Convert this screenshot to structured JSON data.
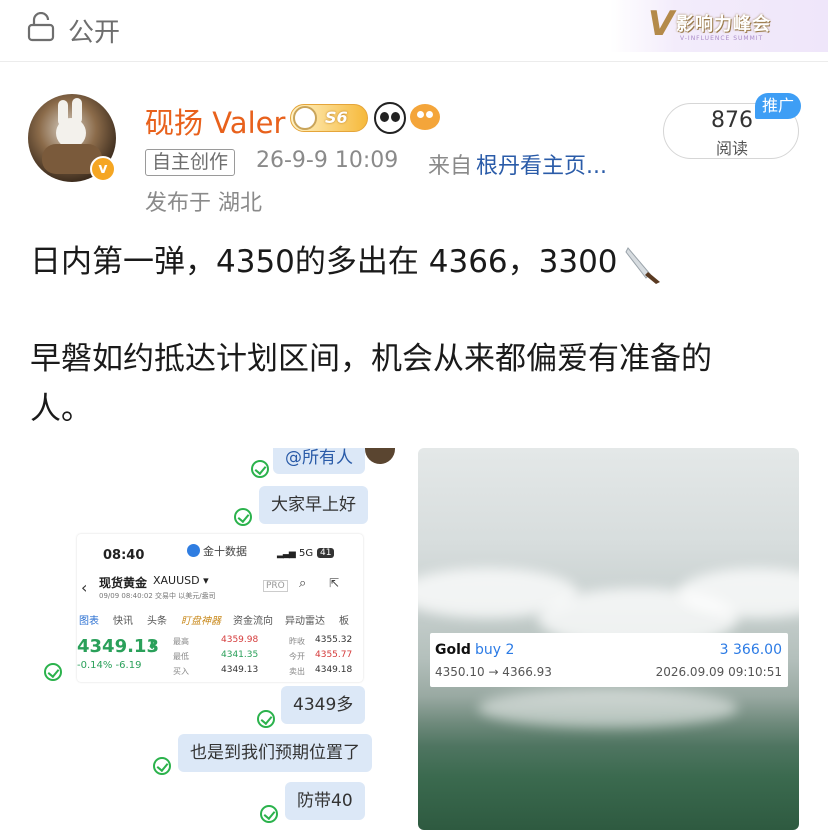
{
  "topbar": {
    "privacy_label": "公开",
    "brand_mark": "V",
    "brand_name": "影响力峰会",
    "brand_sub": "V-INFLUENCE SUMMIT"
  },
  "author": {
    "name": "砚扬 Valer",
    "level": "S6",
    "original_tag": "自主创作",
    "time": "26-9-9 10:09",
    "from_prefix": "来自",
    "source": "根丹看主页...",
    "location": "发布于 湖北",
    "verified_mark": "v"
  },
  "stats": {
    "reads_count": "876",
    "reads_label": "阅读",
    "promo_label": "推广"
  },
  "post": {
    "line1": "日内第一弹，4350的多出在 4366，3300",
    "line2": "早磐如约抵达计划区间，机会从来都偏爱有准备的",
    "line3": "人。"
  },
  "chat_image": {
    "mention": "@所有人",
    "greeting": "大家早上好",
    "msg_price": "4349多",
    "msg_reached": "也是到我们预期位置了",
    "msg_stop": "防带40",
    "phone": {
      "time": "08:40",
      "app": "金十数据",
      "network": "5G",
      "battery": "41",
      "title": "现货黄金",
      "symbol": "XAUUSD ▾",
      "subline": "09/09 08:40:02  交易中  以美元/盎司",
      "pro": "PRO",
      "tabs": [
        "图表",
        "快讯",
        "头条",
        "盯盘神器",
        "资金流向",
        "异动雷达",
        "板"
      ],
      "price": "4349.13",
      "change": "-0.14%  -6.19",
      "stats": [
        {
          "l1": "最高",
          "v1": "4359.98",
          "l2": "昨收",
          "v2": "4355.32"
        },
        {
          "l1": "最低",
          "v1": "4341.35",
          "l2": "今开",
          "v2": "4355.77"
        },
        {
          "l1": "买入",
          "v1": "4349.13",
          "l2": "卖出",
          "v2": "4349.18"
        }
      ]
    }
  },
  "trade_card": {
    "symbol": "Gold",
    "action": "buy 2",
    "profit": "3 366.00",
    "prices": "4350.10 → 4366.93",
    "datetime": "2026.09.09 09:10:51"
  },
  "colors": {
    "username": "#e8611c",
    "link": "#2a5ba8",
    "promo": "#3e9ef5",
    "trade_blue": "#2c7be5"
  }
}
